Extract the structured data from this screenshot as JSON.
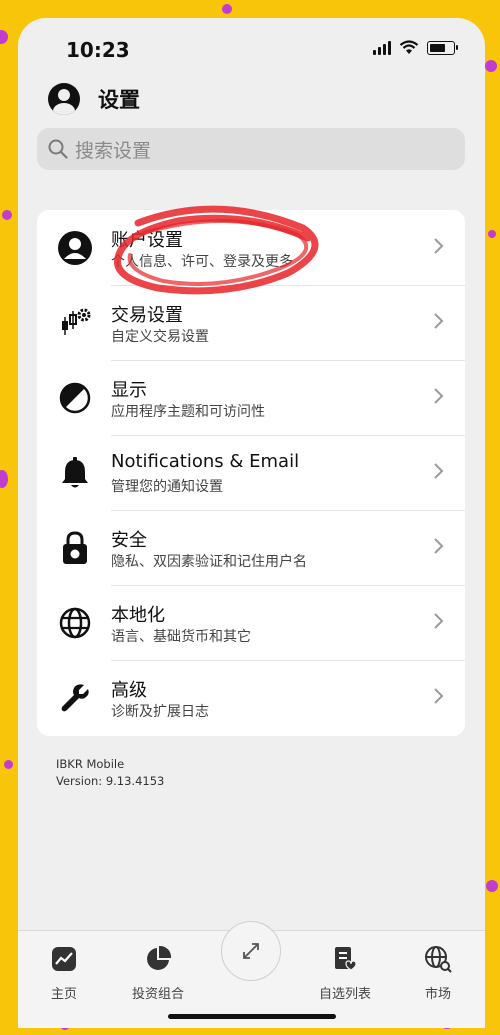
{
  "status_bar": {
    "time": "10:23"
  },
  "header": {
    "title": "设置",
    "icon": "user-avatar-icon"
  },
  "search": {
    "placeholder": "搜索设置",
    "icon": "search-icon"
  },
  "settings": [
    {
      "title": "账户设置",
      "subtitle": "个人信息、许可、登录及更多",
      "icon": "account-icon"
    },
    {
      "title": "交易设置",
      "subtitle": "自定义交易设置",
      "icon": "trading-gear-icon"
    },
    {
      "title": "显示",
      "subtitle": "应用程序主题和可访问性",
      "icon": "display-contrast-icon"
    },
    {
      "title": "Notifications & Email",
      "subtitle": "管理您的通知设置",
      "icon": "bell-icon"
    },
    {
      "title": "安全",
      "subtitle": "隐私、双因素验证和记住用户名",
      "icon": "lock-icon"
    },
    {
      "title": "本地化",
      "subtitle": "语言、基础货币和其它",
      "icon": "globe-icon"
    },
    {
      "title": "高级",
      "subtitle": "诊断及扩展日志",
      "icon": "wrench-icon"
    }
  ],
  "app_info": {
    "name": "IBKR Mobile",
    "version": "Version: 9.13.4153"
  },
  "tabbar": {
    "tabs": [
      {
        "label": "主页",
        "icon": "home-chart-icon"
      },
      {
        "label": "投资组合",
        "icon": "pie-chart-icon"
      },
      {
        "label": "自选列表",
        "icon": "watchlist-icon"
      },
      {
        "label": "市场",
        "icon": "globe-search-icon"
      }
    ],
    "center_icon": "expand-arrows-icon"
  },
  "colors": {
    "background_frame": "#f9c50a",
    "annotation": "#e8252a",
    "accent_dots": "#c33bd0"
  }
}
